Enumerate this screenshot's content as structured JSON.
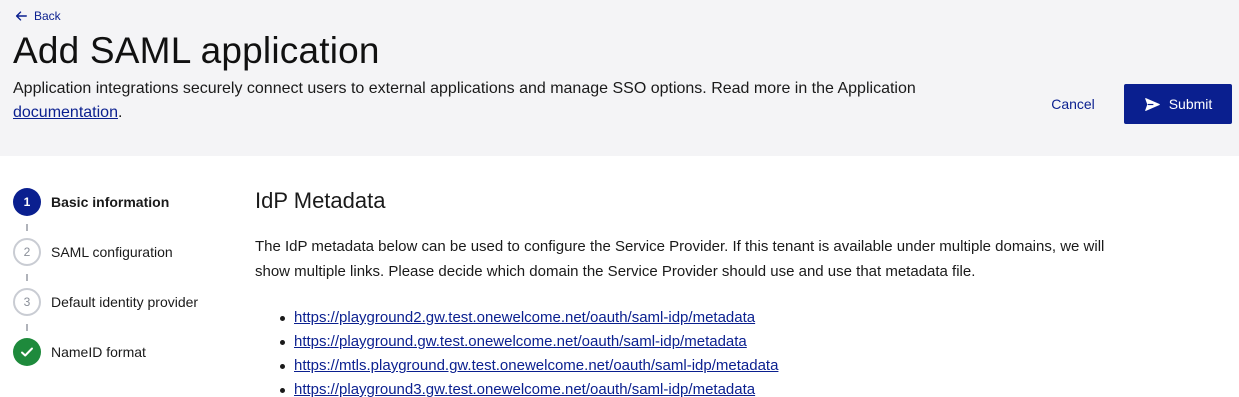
{
  "header": {
    "back_label": "Back",
    "title": "Add SAML application",
    "description": "Application integrations securely connect users to external applications and manage SSO options. Read more in the Application",
    "doc_link": "documentation",
    "doc_suffix": ".",
    "cancel_label": "Cancel",
    "submit_label": "Submit"
  },
  "steps": [
    {
      "number": "1",
      "label": "Basic information",
      "state": "active"
    },
    {
      "number": "2",
      "label": "SAML configuration",
      "state": "pending"
    },
    {
      "number": "3",
      "label": "Default identity provider",
      "state": "pending"
    },
    {
      "number": "",
      "label": "NameID format",
      "state": "done"
    }
  ],
  "main": {
    "heading": "IdP Metadata",
    "paragraph": "The IdP metadata below can be used to configure the Service Provider. If this tenant is available under multiple domains, we will show multiple links. Please decide which domain the Service Provider should use and use that metadata file.",
    "links": [
      "https://playground2.gw.test.onewelcome.net/oauth/saml-idp/metadata",
      "https://playground.gw.test.onewelcome.net/oauth/saml-idp/metadata",
      "https://mtls.playground.gw.test.onewelcome.net/oauth/saml-idp/metadata",
      "https://playground3.gw.test.onewelcome.net/oauth/saml-idp/metadata"
    ]
  },
  "icons": {
    "back": "arrow-left-icon",
    "submit": "send-icon",
    "step_done": "check-icon"
  },
  "colors": {
    "primary": "#0a1f8f",
    "success": "#1e8a3c",
    "header_bg": "#f4f4f6"
  }
}
